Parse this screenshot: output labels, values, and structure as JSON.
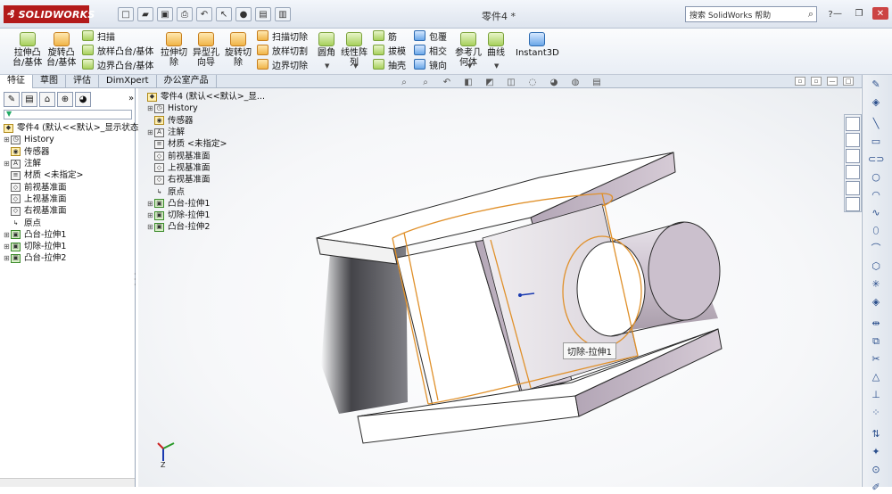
{
  "titlebar": {
    "logo_text": "SOLIDWORKS",
    "doc_title": "零件4 *",
    "help_search_placeholder": "搜索 SolidWorks 帮助",
    "quick_access": [
      "new-icon",
      "open-icon",
      "save-icon",
      "print-icon",
      "undo-icon",
      "select-icon",
      "rebuild-icon",
      "file-properties-icon",
      "options-icon"
    ]
  },
  "ribbon": {
    "large_buttons": [
      {
        "label": "拉伸凸\n台/基体",
        "icon": "extrude-boss-icon"
      },
      {
        "label": "旋转凸\n台/基体",
        "icon": "revolve-boss-icon"
      },
      {
        "label": "拉伸切\n除",
        "icon": "extrude-cut-icon"
      },
      {
        "label": "异型孔\n向导",
        "icon": "hole-wizard-icon"
      },
      {
        "label": "旋转切\n除",
        "icon": "revolve-cut-icon"
      },
      {
        "label": "圆角",
        "icon": "fillet-icon"
      },
      {
        "label": "线性阵\n列",
        "icon": "linear-pattern-icon"
      },
      {
        "label": "参考几\n何体",
        "icon": "reference-geometry-icon"
      },
      {
        "label": "曲线",
        "icon": "curves-icon"
      },
      {
        "label": "Instant3D",
        "icon": "instant3d-icon"
      }
    ],
    "small_buttons": [
      {
        "label": "扫描"
      },
      {
        "label": "放样凸台/基体"
      },
      {
        "label": "边界凸台/基体"
      },
      {
        "label": "扫描切除"
      },
      {
        "label": "放样切割"
      },
      {
        "label": "边界切除"
      },
      {
        "label": "筋"
      },
      {
        "label": "拔模"
      },
      {
        "label": "抽壳"
      },
      {
        "label": "包覆"
      },
      {
        "label": "相交"
      },
      {
        "label": "镜向"
      }
    ]
  },
  "tabs": [
    "特征",
    "草图",
    "评估",
    "DimXpert",
    "办公室产品"
  ],
  "left_tree": {
    "root": "零件4 (默认<<默认>_显示状态",
    "items": [
      {
        "label": "History",
        "icon": "history-icon"
      },
      {
        "label": "传感器",
        "icon": "sensor-icon"
      },
      {
        "label": "注解",
        "icon": "annotation-icon"
      },
      {
        "label": "材质 <未指定>",
        "icon": "material-icon"
      },
      {
        "label": "前视基准面",
        "icon": "plane-icon"
      },
      {
        "label": "上视基准面",
        "icon": "plane-icon"
      },
      {
        "label": "右视基准面",
        "icon": "plane-icon"
      },
      {
        "label": "原点",
        "icon": "origin-icon"
      },
      {
        "label": "凸台-拉伸1",
        "icon": "boss-extrude-icon"
      },
      {
        "label": "切除-拉伸1",
        "icon": "cut-extrude-icon"
      },
      {
        "label": "凸台-拉伸2",
        "icon": "boss-extrude-icon"
      }
    ]
  },
  "viewport_tree": {
    "root": "零件4 (默认<<默认>_显...",
    "items": [
      {
        "label": "History"
      },
      {
        "label": "传感器"
      },
      {
        "label": "注解"
      },
      {
        "label": "材质 <未指定>"
      },
      {
        "label": "前视基准面"
      },
      {
        "label": "上视基准面"
      },
      {
        "label": "右视基准面"
      },
      {
        "label": "原点"
      },
      {
        "label": "凸台-拉伸1"
      },
      {
        "label": "切除-拉伸1"
      },
      {
        "label": "凸台-拉伸2"
      }
    ]
  },
  "viewport": {
    "tooltip": "切除-拉伸1",
    "triad_label": "Z"
  },
  "colors": {
    "accent": "#b31b1b",
    "edge_highlight": "#e0902a",
    "face_side": "#c9bccb",
    "face_top": "#ffffff"
  }
}
